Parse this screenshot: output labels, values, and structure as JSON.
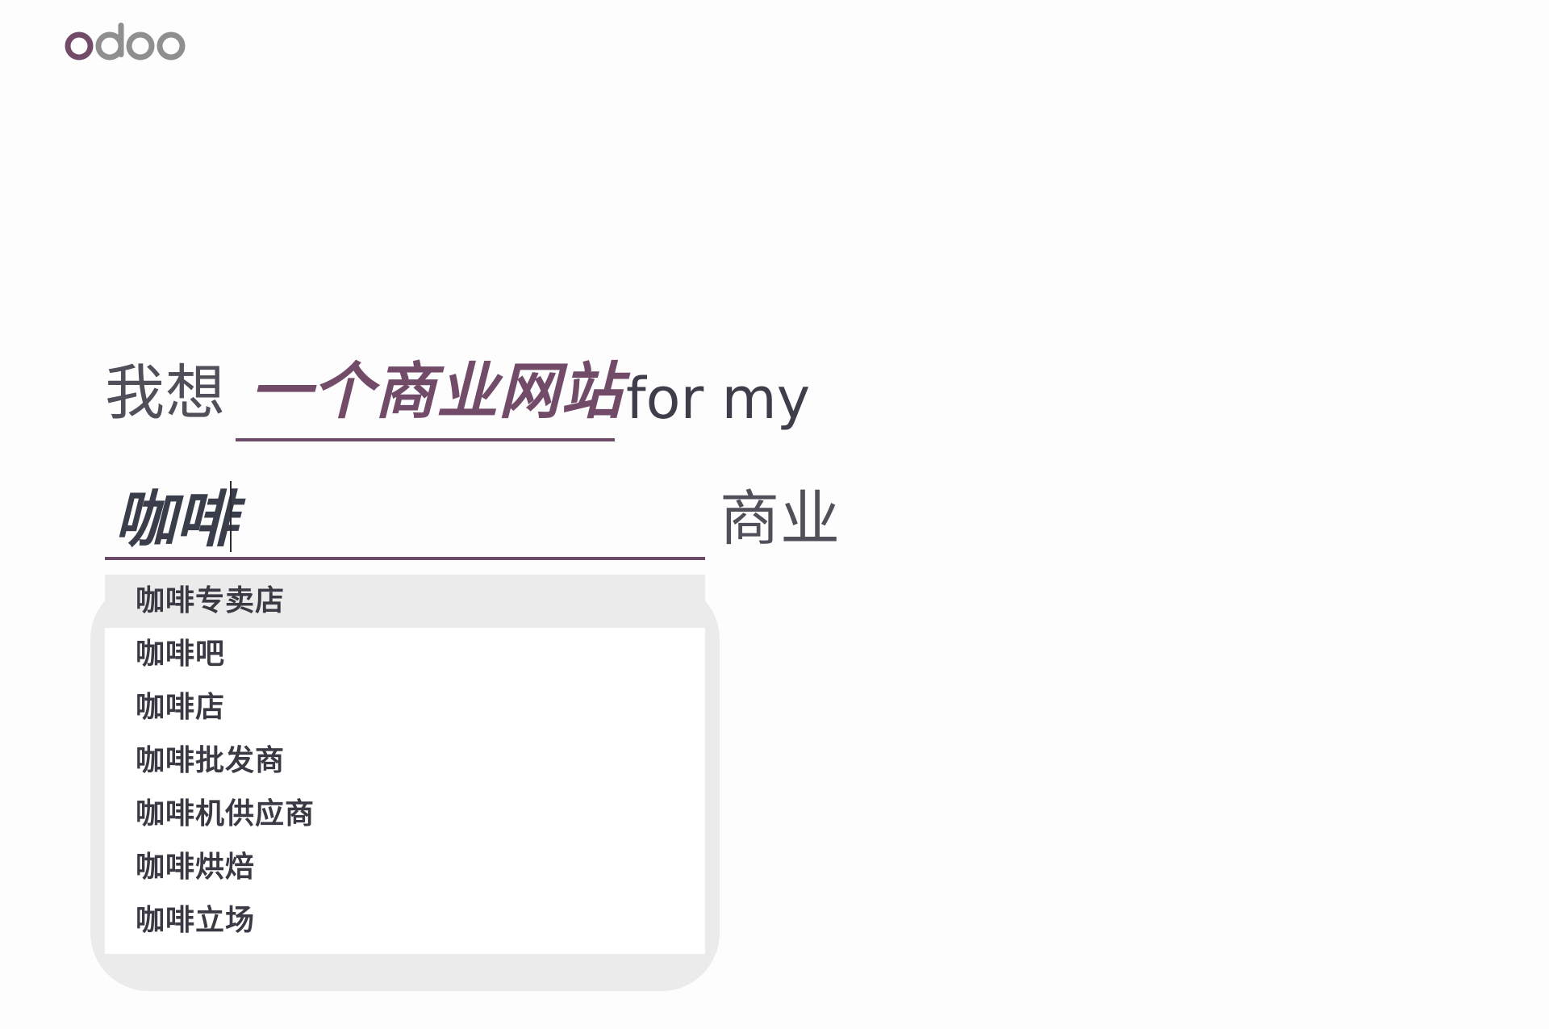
{
  "logo": {
    "text": "odoo",
    "colors": {
      "first_letter": "#714b67",
      "rest": "#8f8f8f"
    }
  },
  "sentence": {
    "prefix": "我想",
    "selection": "一个商业网站",
    "suffix": "for my"
  },
  "industry": {
    "value": "咖啡",
    "suffix": "商业"
  },
  "dropdown": {
    "items": [
      {
        "label": "咖啡专卖店",
        "active": true
      },
      {
        "label": "咖啡吧"
      },
      {
        "label": "咖啡店"
      },
      {
        "label": "咖啡批发商"
      },
      {
        "label": "咖啡机供应商"
      },
      {
        "label": "咖啡烘焙"
      },
      {
        "label": "咖啡立场"
      }
    ]
  },
  "colors": {
    "accent": "#714b67",
    "text_dark": "#2c2c36",
    "highlight": "#ebebeb"
  }
}
